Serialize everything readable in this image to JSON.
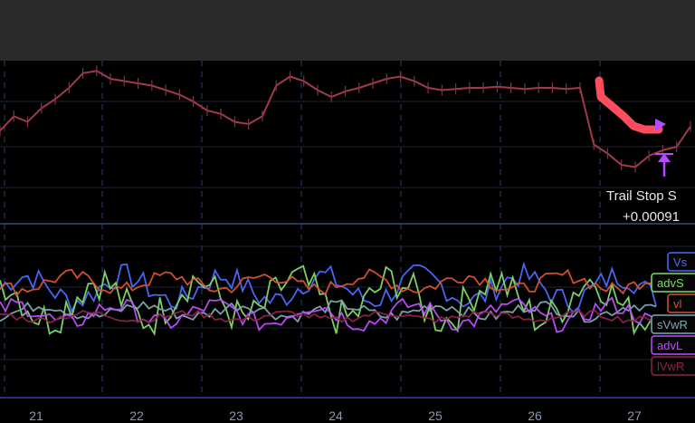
{
  "chart_data": [
    {
      "type": "line",
      "panel": "price",
      "title": "",
      "x_ticks": [
        "21",
        "22",
        "23",
        "24",
        "25",
        "26",
        "27"
      ],
      "series": [
        {
          "values": [
            0.42,
            0.55,
            0.5,
            0.62,
            0.7,
            0.8,
            0.93,
            0.95,
            0.88,
            0.86,
            0.84,
            0.82,
            0.78,
            0.74,
            0.68,
            0.6,
            0.57,
            0.5,
            0.48,
            0.55,
            0.82,
            0.9,
            0.86,
            0.78,
            0.72,
            0.77,
            0.8,
            0.84,
            0.88,
            0.9,
            0.86,
            0.8,
            0.78,
            0.79,
            0.8,
            0.8,
            0.81,
            0.8,
            0.79,
            0.8,
            0.8,
            0.79,
            0.8,
            0.3,
            0.22,
            0.12,
            0.1,
            0.2,
            0.25,
            0.28,
            0.46
          ]
        }
      ],
      "colors": {
        "price": "#a33a4c",
        "trail": "#ff4d5e",
        "grid": "#1e2433",
        "marker": "#b34bff"
      },
      "annotation": {
        "line1": "Trail Stop S",
        "line2": "+0.00091"
      }
    },
    {
      "type": "line",
      "panel": "indicators",
      "x_ticks": [
        "21",
        "22",
        "23",
        "24",
        "25",
        "26",
        "27"
      ],
      "series": [
        {
          "name": "Vs",
          "color": "#4a6cff",
          "base": 0.55,
          "amp": 0.22
        },
        {
          "name": "advS",
          "color": "#7fdb6a",
          "base": 0.45,
          "amp": 0.35
        },
        {
          "name": "vl",
          "color": "#d9542c",
          "base": 0.6,
          "amp": 0.12
        },
        {
          "name": "sVwR",
          "color": "#7fa9b0",
          "base": 0.35,
          "amp": 0.1
        },
        {
          "name": "advL",
          "color": "#c04dff",
          "base": 0.32,
          "amp": 0.16
        },
        {
          "name": "lVwR",
          "color": "#8a2448",
          "base": 0.3,
          "amp": 0.06
        }
      ]
    }
  ]
}
